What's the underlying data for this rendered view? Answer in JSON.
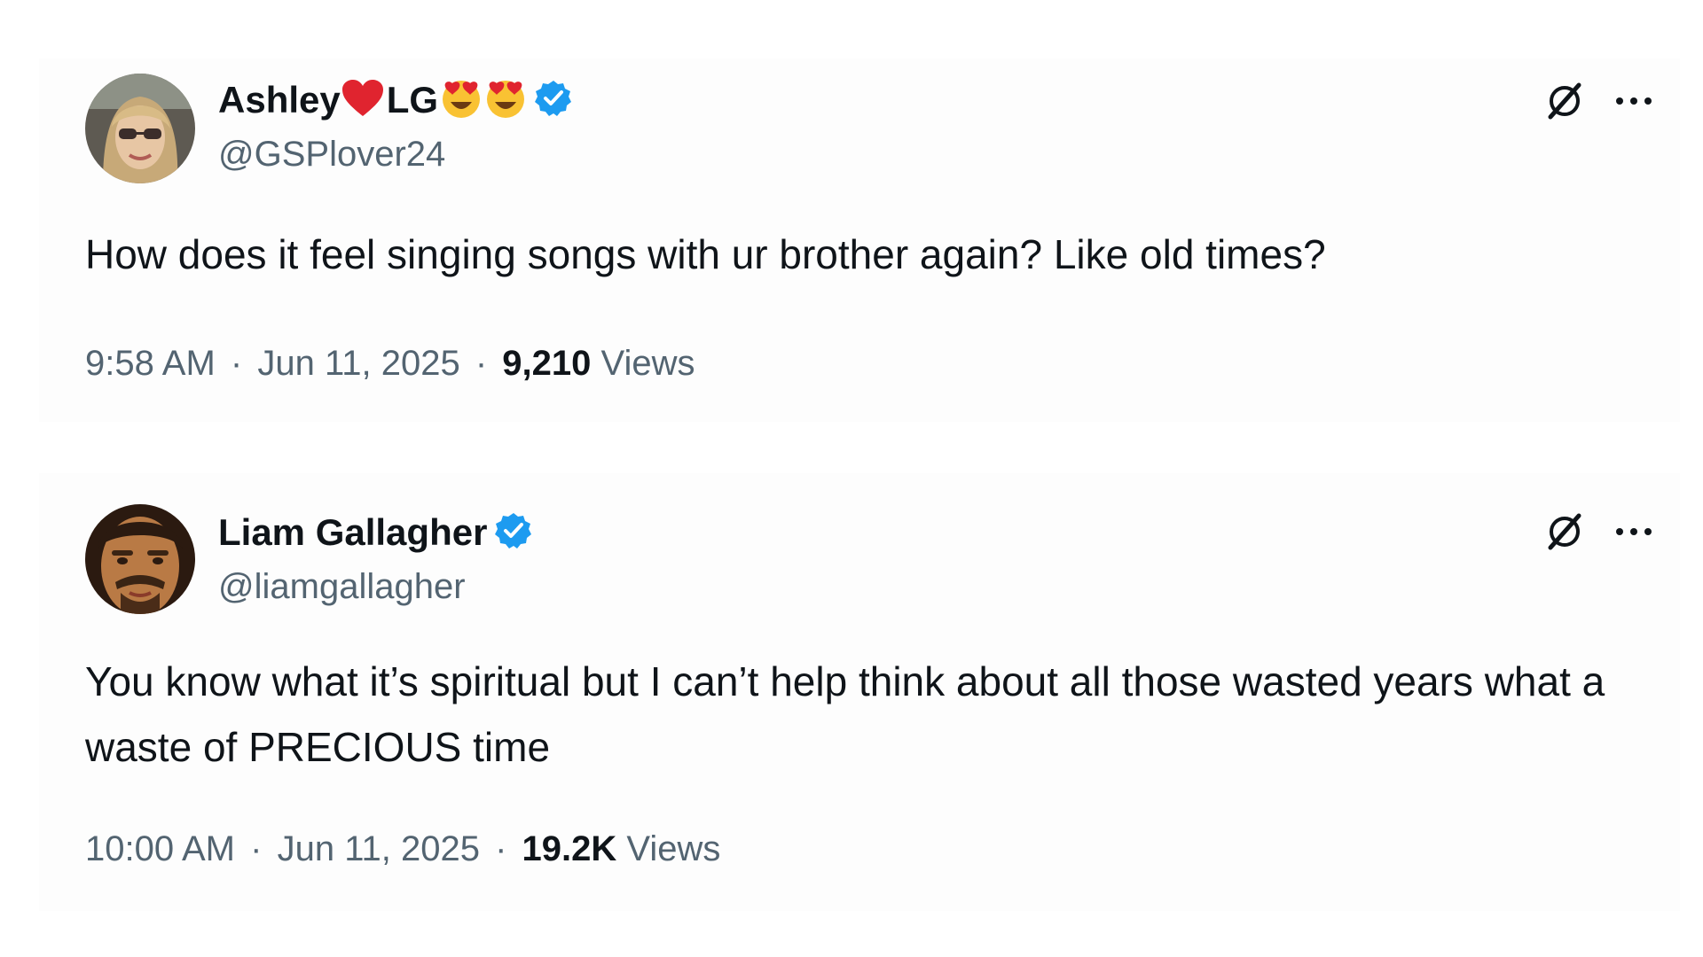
{
  "tweets": [
    {
      "display_name_prefix": "Ashley",
      "display_name_suffix": "LG",
      "name_emojis": [
        "red-heart-icon",
        "heart-eyes-emoji-icon",
        "heart-eyes-emoji-icon"
      ],
      "verified": true,
      "handle": "@GSPlover24",
      "text": "How does it feel singing songs with ur brother again? Like old times?",
      "time": "9:58 AM",
      "separator": "·",
      "date": "Jun 11, 2025",
      "views_count": "9,210",
      "views_label": "Views"
    },
    {
      "display_name_prefix": "Liam Gallagher",
      "verified": true,
      "handle": "@liamgallagher",
      "text": "You know what it’s spiritual but I can’t help think about all those wasted years what a waste of PRECIOUS time",
      "time": "10:00 AM",
      "separator": "·",
      "date": "Jun 11, 2025",
      "views_count": "19.2K",
      "views_label": "Views"
    }
  ],
  "colors": {
    "text_primary": "#0f1419",
    "text_secondary": "#536471",
    "verified_blue": "#1d9bf0",
    "heart_red": "#e0242f",
    "emoji_yellow": "#f9c233"
  },
  "icons": {
    "grok": "grok-icon",
    "more": "more-dots-icon",
    "verified": "verified-badge-icon"
  }
}
